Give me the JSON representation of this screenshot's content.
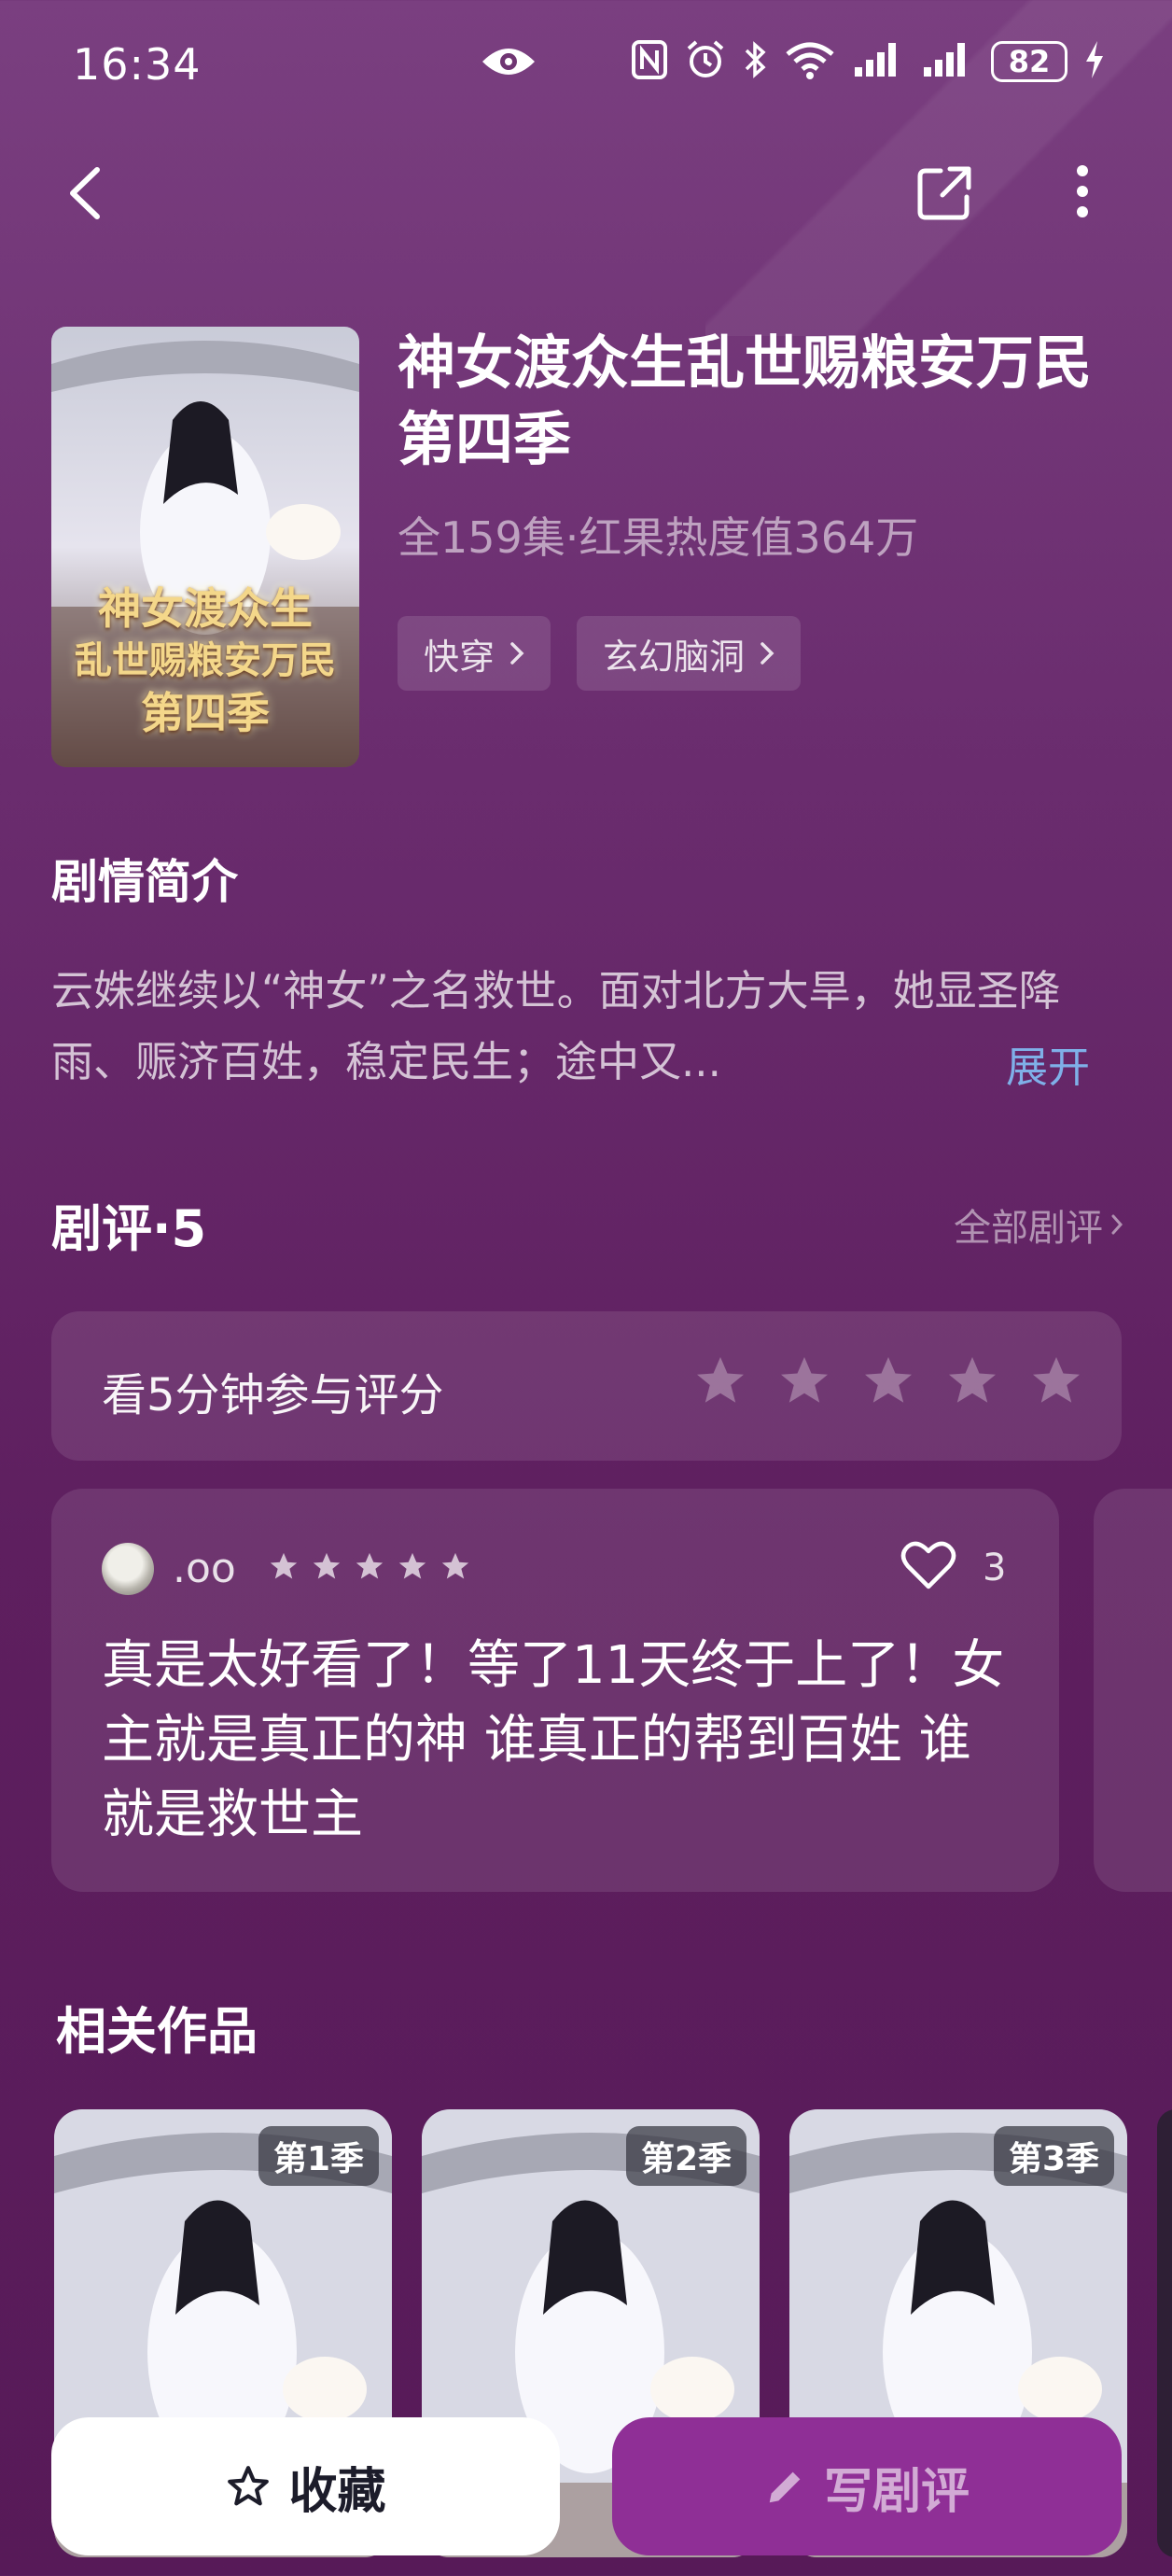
{
  "status_bar": {
    "time": "16:34",
    "battery": "82",
    "icons": [
      "eye-icon",
      "nfc-icon",
      "alarm-icon",
      "bluetooth-icon",
      "wifi-icon",
      "signal-icon",
      "signal-icon",
      "battery-icon",
      "charging-icon"
    ]
  },
  "nav": {
    "back": "back-icon",
    "share": "share-icon",
    "more": "more-icon"
  },
  "show": {
    "title": "神女渡众生乱世赐粮安万民第四季",
    "poster_title_lines": [
      "神女渡众生",
      "乱世赐粮安万民",
      "第四季"
    ],
    "meta": "全159集·红果热度值364万",
    "tags": [
      {
        "label": "快穿"
      },
      {
        "label": "玄幻脑洞"
      }
    ]
  },
  "synopsis": {
    "title": "剧情简介",
    "text": "云姝继续以“神女”之名救世。面对北方大旱，她显圣降雨、赈济百姓，稳定民生；途中又...",
    "expand": "展开"
  },
  "reviews": {
    "header": "剧评·5",
    "all_link": "全部剧评",
    "rate_prompt": "看5分钟参与评分",
    "rate_stars": 5,
    "items": [
      {
        "name": ".oo",
        "stars": 5,
        "likes": "3",
        "text": "真是太好看了！等了11天终于上了！女主就是真正的神 谁真正的帮到百姓 谁就是救世主"
      }
    ]
  },
  "related": {
    "title": "相关作品",
    "items": [
      {
        "badge": "第1季"
      },
      {
        "badge": "第2季"
      },
      {
        "badge": "第3季"
      }
    ]
  },
  "bottom": {
    "favorite": "收藏",
    "write_review": "写剧评"
  },
  "colors": {
    "background": "#6a2c6e",
    "accent_button": "#8f2f96",
    "expand_link": "#7fb0e8"
  }
}
